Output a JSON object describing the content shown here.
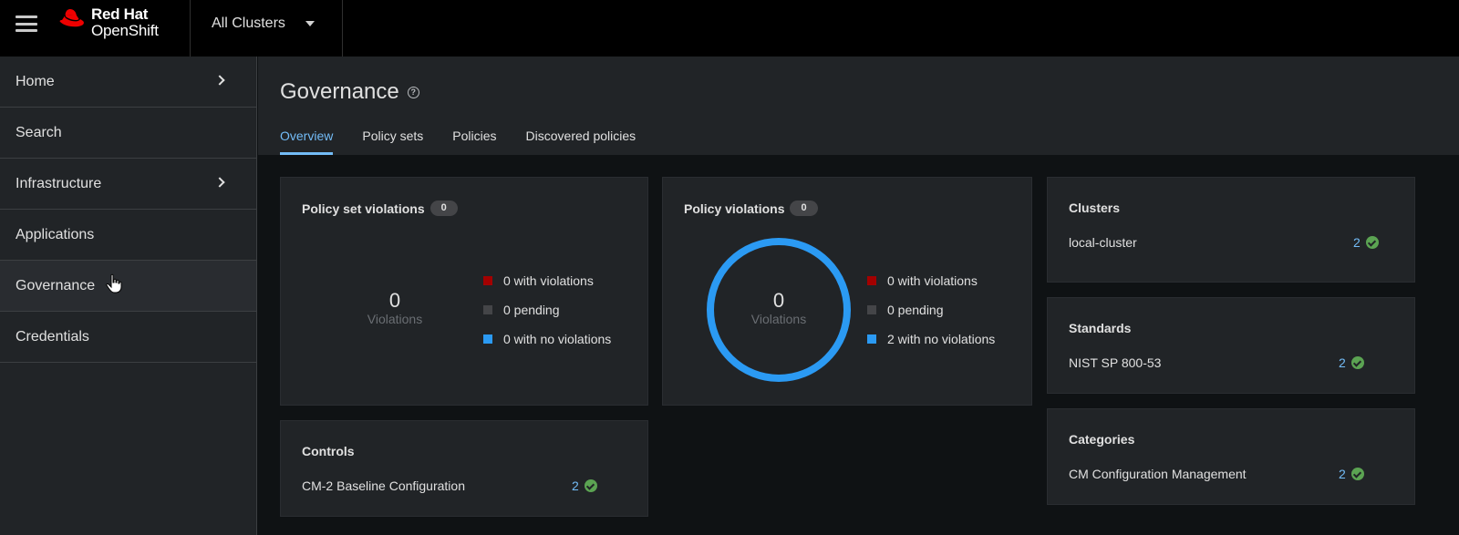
{
  "masthead": {
    "brand_line1": "Red Hat",
    "brand_line2": "OpenShift",
    "cluster_selector": "All Clusters",
    "icons": [
      "hamburger-icon",
      "redhat-logo",
      "caret-down-icon"
    ]
  },
  "sidebar": {
    "items": [
      {
        "label": "Home",
        "has_chevron": true
      },
      {
        "label": "Search",
        "has_chevron": false
      },
      {
        "label": "Infrastructure",
        "has_chevron": true
      },
      {
        "label": "Applications",
        "has_chevron": false
      },
      {
        "label": "Governance",
        "has_chevron": false,
        "active": true
      },
      {
        "label": "Credentials",
        "has_chevron": false
      }
    ]
  },
  "page": {
    "title": "Governance",
    "help_icon": "?",
    "tabs": [
      {
        "label": "Overview",
        "active": true
      },
      {
        "label": "Policy sets"
      },
      {
        "label": "Policies"
      },
      {
        "label": "Discovered policies"
      }
    ]
  },
  "policy_set_violations": {
    "title": "Policy set violations",
    "badge": "0",
    "center_value": "0",
    "center_label": "Violations",
    "legend": [
      {
        "label": "0 with violations",
        "color": "#a30000"
      },
      {
        "label": "0 pending",
        "color": "#444548"
      },
      {
        "label": "0 with no violations",
        "color": "#2b9af3"
      }
    ]
  },
  "policy_violations": {
    "title": "Policy violations",
    "badge": "0",
    "center_value": "0",
    "center_label": "Violations",
    "legend": [
      {
        "label": "0 with violations",
        "color": "#a30000"
      },
      {
        "label": "0 pending",
        "color": "#444548"
      },
      {
        "label": "2 with no violations",
        "color": "#2b9af3"
      }
    ],
    "donut_color": "#2b9af3"
  },
  "clusters": {
    "title": "Clusters",
    "rows": [
      {
        "name": "local-cluster",
        "count": "2"
      }
    ]
  },
  "standards": {
    "title": "Standards",
    "rows": [
      {
        "name": "NIST SP 800-53",
        "count": "2"
      }
    ]
  },
  "categories": {
    "title": "Categories",
    "rows": [
      {
        "name": "CM Configuration Management",
        "count": "2"
      }
    ]
  },
  "controls": {
    "title": "Controls",
    "rows": [
      {
        "name": "CM-2 Baseline Configuration",
        "count": "2"
      }
    ]
  },
  "colors": {
    "accent": "#73bcf7",
    "success": "#5ba352",
    "danger": "#a30000",
    "pending": "#444548",
    "info": "#2b9af3"
  }
}
